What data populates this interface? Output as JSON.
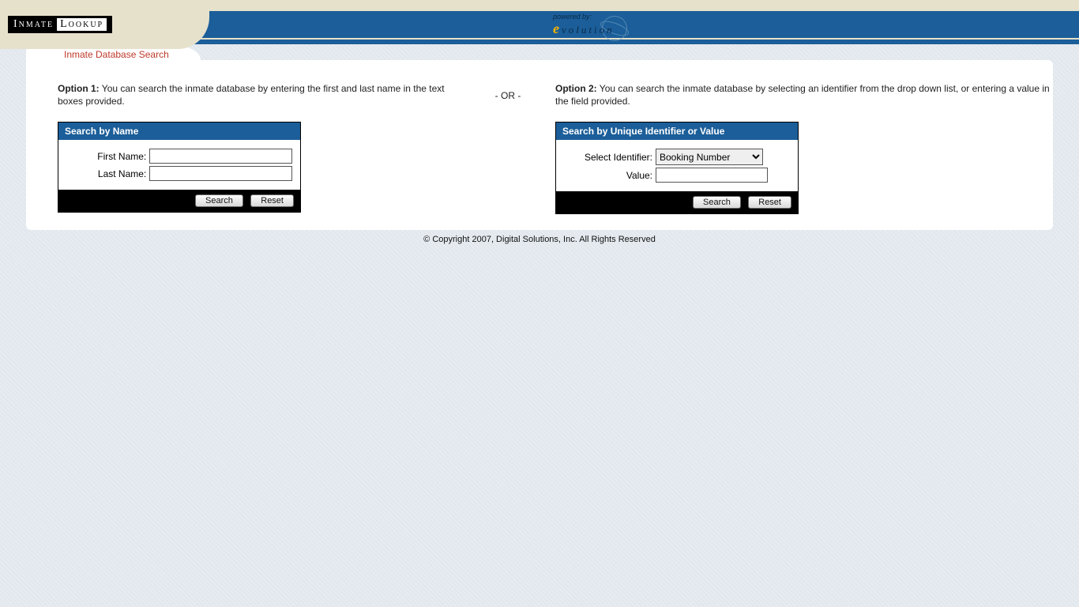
{
  "logo": {
    "part1": "Inmate",
    "part2": "Lookup"
  },
  "powered": {
    "label": "powered by:",
    "brand_e": "e",
    "brand_rest": "volution"
  },
  "tab": {
    "title": "Inmate Database Search"
  },
  "option1": {
    "label": "Option 1:",
    "text": " You can search the inmate database by entering the first and last name in the text boxes provided."
  },
  "or": "- OR -",
  "option2": {
    "label": "Option 2:",
    "text": " You can search the inmate database by selecting an identifier from the drop down list, or entering a value in the field provided."
  },
  "panel1": {
    "header": "Search by Name",
    "first_label": "First Name:",
    "last_label": "Last Name:",
    "first_value": "",
    "last_value": "",
    "search": "Search",
    "reset": "Reset"
  },
  "panel2": {
    "header": "Search by Unique Identifier or Value",
    "select_label": "Select Identifier:",
    "value_label": "Value:",
    "selected": "Booking Number",
    "value": "",
    "search": "Search",
    "reset": "Reset"
  },
  "footer": "© Copyright 2007, Digital Solutions, Inc. All Rights Reserved"
}
